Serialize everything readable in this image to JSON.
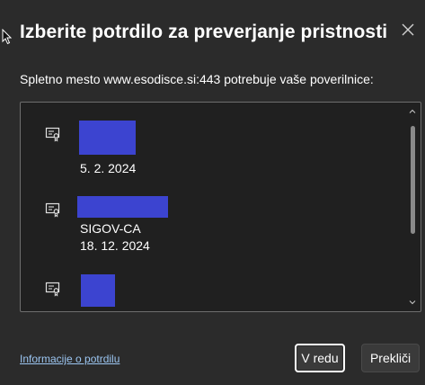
{
  "dialog": {
    "title": "Izberite potrdilo za preverjanje pristnosti",
    "subtitle": "Spletno mesto www.esodisce.si:443 potrebuje vaše poverilnice:",
    "close_icon": "close-icon"
  },
  "certificates": [
    {
      "icon": "certificate-icon",
      "line1": "5. 2. 2024"
    },
    {
      "icon": "certificate-icon",
      "line1": "SIGOV-CA",
      "line2": "18. 12. 2024"
    },
    {
      "icon": "certificate-icon"
    }
  ],
  "footer": {
    "info_link": "Informacije o potrdilu",
    "ok_label": "V redu",
    "cancel_label": "Prekliči"
  },
  "colors": {
    "background": "#2b2b2b",
    "list_background": "#202020",
    "redaction": "#3c44d0",
    "link": "#9cc6f2"
  }
}
